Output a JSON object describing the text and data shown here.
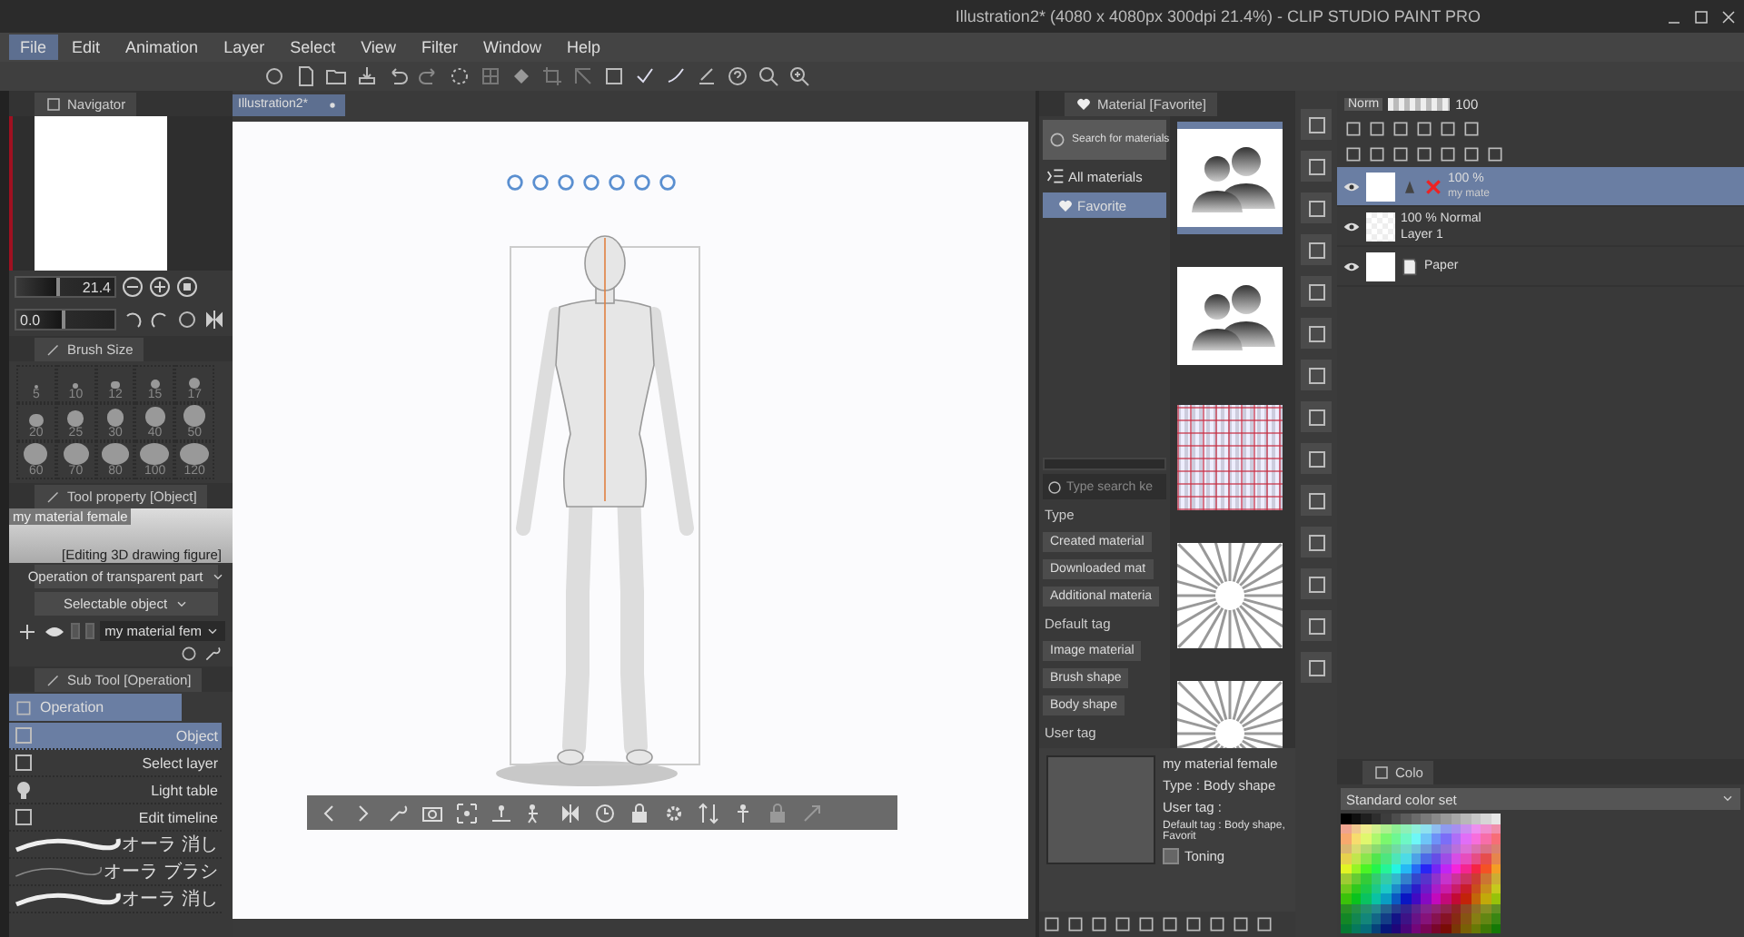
{
  "window": {
    "title": "Illustration2* (4080 x 4080px 300dpi 21.4%) - CLIP STUDIO PAINT PRO"
  },
  "menu": [
    {
      "label": "File",
      "selected": true
    },
    {
      "label": "Edit",
      "selected": false
    },
    {
      "label": "Animation",
      "selected": false
    },
    {
      "label": "Layer",
      "selected": false
    },
    {
      "label": "Select",
      "selected": false
    },
    {
      "label": "View",
      "selected": false
    },
    {
      "label": "Filter",
      "selected": false
    },
    {
      "label": "Window",
      "selected": false
    },
    {
      "label": "Help",
      "selected": false
    }
  ],
  "navigator": {
    "tab": "Navigator",
    "zoom": {
      "value": "21.4",
      "level": 0.45
    },
    "rotation": {
      "value": "0.0",
      "level": 0.5
    }
  },
  "brush_size": {
    "tab": "Brush Size",
    "sizes": [
      "5",
      "10",
      "12",
      "15",
      "17",
      "20",
      "25",
      "30",
      "40",
      "50",
      "60",
      "70",
      "80",
      "100",
      "120"
    ]
  },
  "tool_property": {
    "tab": "Tool property [Object]",
    "material_name": "my material female",
    "status": "[Editing 3D drawing figure]",
    "dropdowns": [
      "Operation of transparent part",
      "Selectable object"
    ],
    "object_select": "my material fem",
    "toggles": [
      {
        "checked": false
      },
      {
        "checked": false
      }
    ]
  },
  "sub_tool": {
    "tab": "Sub Tool [Operation]",
    "group": "Operation",
    "items": [
      {
        "label": "Object",
        "kind": "tool",
        "selected": true
      },
      {
        "label": "Select layer",
        "kind": "tool",
        "selected": false
      },
      {
        "label": "Light table",
        "kind": "tool",
        "selected": false
      },
      {
        "label": "Edit timeline",
        "kind": "tool",
        "selected": false
      },
      {
        "label": "オーラ 消し",
        "kind": "brush",
        "selected": false
      },
      {
        "label": "オーラ ブラシ",
        "kind": "brush",
        "selected": false
      },
      {
        "label": "オーラ 消し",
        "kind": "brush",
        "selected": false
      }
    ]
  },
  "document_tab": {
    "label": "Illustration2*"
  },
  "material": {
    "tab": "Material [Favorite]",
    "search_button": "Search for materials",
    "tree": [
      {
        "label": "All materials",
        "selected": false
      },
      {
        "label": "Favorite",
        "selected": true
      }
    ],
    "search": {
      "placeholder": "Type search ke"
    },
    "tag_groups": [
      {
        "heading": "Type",
        "tags": [
          "Created material",
          "Downloaded mat",
          "Additional materia"
        ]
      },
      {
        "heading": "Default tag",
        "tags": [
          "Image material",
          "Brush shape",
          "Body shape"
        ]
      },
      {
        "heading": "User tag"
      }
    ],
    "thumbnails": [
      {
        "kind": "silhouette",
        "selected": true
      },
      {
        "kind": "silhouette",
        "selected": false
      },
      {
        "kind": "plaid",
        "selected": false
      },
      {
        "kind": "burst",
        "selected": false
      },
      {
        "kind": "burst",
        "selected": false
      }
    ],
    "detail": {
      "name": "my material female",
      "type": "Type : Body shape",
      "user_tag": "User tag :",
      "default_tag": "Default tag : Body shape, Favorit",
      "toning": {
        "label": "Toning",
        "checked": false
      }
    }
  },
  "layers": {
    "blend_mode": "Norm",
    "opacity": {
      "value": "100",
      "level": 1
    },
    "items": [
      {
        "kind": "figure",
        "opacity_mode": "100 %",
        "name": "my mate",
        "selected": true
      },
      {
        "kind": "raster",
        "opacity_mode": "100 % Normal",
        "name": "Layer 1",
        "selected": false
      },
      {
        "kind": "paper",
        "name": "Paper",
        "selected": false
      }
    ]
  },
  "color_set": {
    "tab": "Colo",
    "set_name": "Standard color set"
  }
}
